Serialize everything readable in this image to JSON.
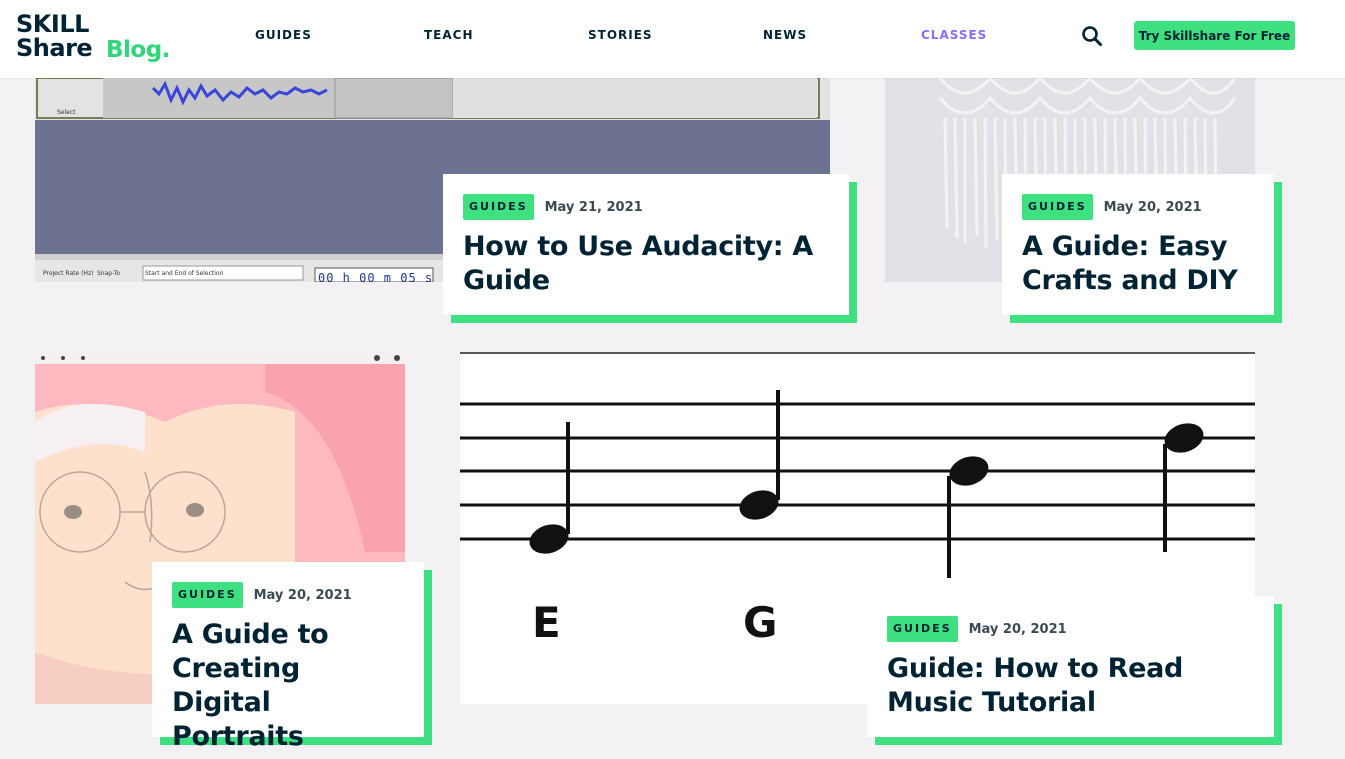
{
  "logo": {
    "line1": "SKILL",
    "line2": "Share",
    "line3": "Blog."
  },
  "nav": [
    {
      "label": "GUIDES"
    },
    {
      "label": "TEACH"
    },
    {
      "label": "STORIES"
    },
    {
      "label": "NEWS"
    },
    {
      "label": "CLASSES",
      "active": true
    }
  ],
  "cta_label": "Try Skillshare For Free",
  "audacity_ui": {
    "project_rate": "Project Rate (Hz)",
    "snap_to": "Snap-To",
    "selection": "Start and End of Selection",
    "time": "00 h 00 m 05 s",
    "select": "Select"
  },
  "music_notes": [
    "E",
    "G"
  ],
  "cards": [
    {
      "badge": "GUIDES",
      "date": "May 21, 2021",
      "title": "How to Use Audacity: A Guide"
    },
    {
      "badge": "GUIDES",
      "date": "May 20, 2021",
      "title": "A Guide: Easy Crafts and DIY"
    },
    {
      "badge": "GUIDES",
      "date": "May 20, 2021",
      "title": "A Guide to Creating Digital Portraits"
    },
    {
      "badge": "GUIDES",
      "date": "May 20, 2021",
      "title": "Guide: How to Read Music Tutorial"
    }
  ],
  "colors": {
    "accent": "#3ee07f",
    "navy": "#002333",
    "classes": "#8d6cf2",
    "background": "#f3f1f4"
  }
}
